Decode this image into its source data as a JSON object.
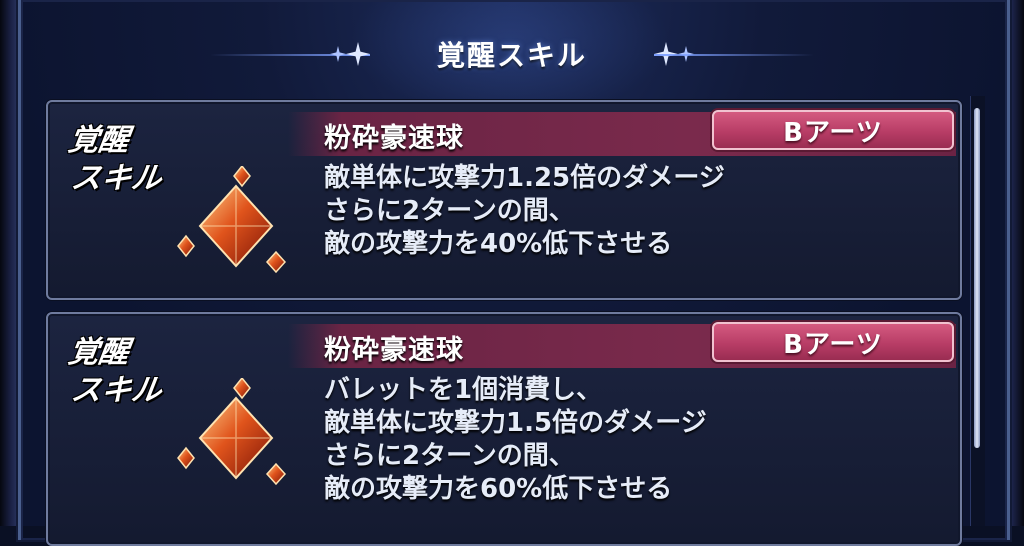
{
  "header": {
    "title": "覚醒スキル"
  },
  "skills": [
    {
      "awaken_label_line1": "覚醒",
      "awaken_label_line2": "スキル",
      "name": "粉砕豪速球",
      "type": "Bアーツ",
      "description": [
        "敵単体に攻撃力1.25倍のダメージ",
        "さらに2ターンの間、",
        "敵の攻撃力を40%低下させる"
      ],
      "icon": "red-crystal-gem-icon"
    },
    {
      "awaken_label_line1": "覚醒",
      "awaken_label_line2": "スキル",
      "name": "粉砕豪速球",
      "type": "Bアーツ",
      "description": [
        "バレットを1個消費し、",
        "敵単体に攻撃力1.5倍のダメージ",
        "さらに2ターンの間、",
        "敵の攻撃力を60%低下させる"
      ],
      "icon": "red-crystal-gem-icon"
    }
  ],
  "colors": {
    "background": "#0c1430",
    "badge": "#b83d66",
    "band": "#7a2a4c",
    "text": "#e6ecf8"
  }
}
